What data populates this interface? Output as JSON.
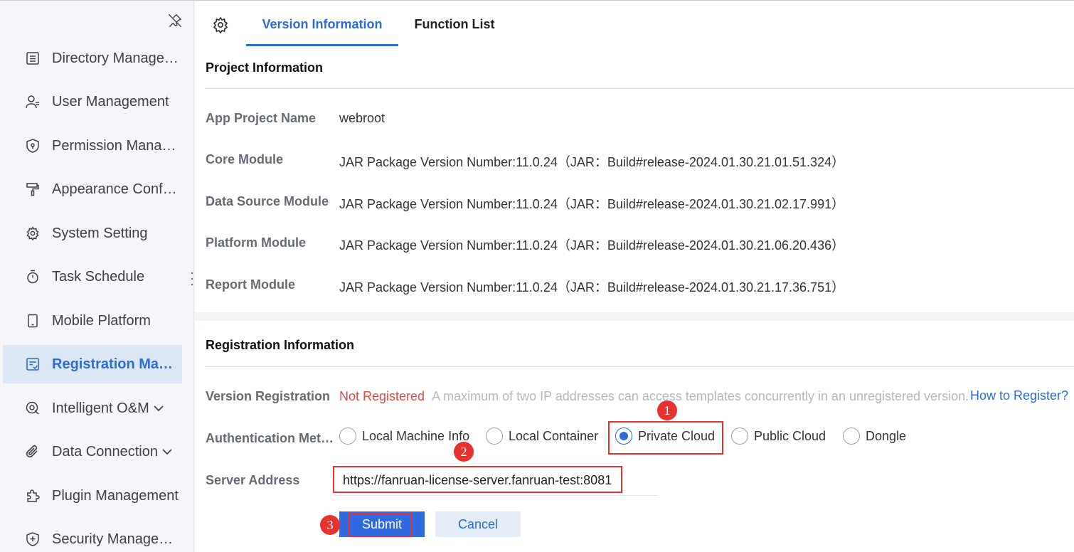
{
  "sidebar": {
    "pin_icon": "pin-off-icon",
    "items": [
      {
        "label": "Directory Management",
        "icon": "list-icon"
      },
      {
        "label": "User Management",
        "icon": "user-icon"
      },
      {
        "label": "Permission Management",
        "icon": "shield-icon"
      },
      {
        "label": "Appearance Configuration",
        "icon": "paint-roller-icon"
      },
      {
        "label": "System Setting",
        "icon": "gear-icon"
      },
      {
        "label": "Task Schedule",
        "icon": "stopwatch-icon"
      },
      {
        "label": "Mobile Platform",
        "icon": "mobile-icon"
      },
      {
        "label": "Registration Management",
        "icon": "registration-icon",
        "active": true
      },
      {
        "label": "Intelligent O&M",
        "icon": "ops-icon",
        "has_children": true
      },
      {
        "label": "Data Connection",
        "icon": "paperclip-icon",
        "has_children": true
      },
      {
        "label": "Plugin Management",
        "icon": "puzzle-icon"
      },
      {
        "label": "Security Management",
        "icon": "shield-plus-icon"
      }
    ]
  },
  "tabs": {
    "settings_icon": "gear-icon",
    "version": "Version Information",
    "function": "Function List",
    "active": "version"
  },
  "project": {
    "title": "Project Information",
    "rows": [
      {
        "label": "App Project Name",
        "value": "webroot"
      },
      {
        "label": "Core Module",
        "value": "JAR Package Version Number:11.0.24（JAR：Build#release-2024.01.30.21.01.51.324）"
      },
      {
        "label": "Data Source Module",
        "value": "JAR Package Version Number:11.0.24（JAR：Build#release-2024.01.30.21.02.17.991）"
      },
      {
        "label": "Platform Module",
        "value": "JAR Package Version Number:11.0.24（JAR：Build#release-2024.01.30.21.06.20.436）"
      },
      {
        "label": "Report Module",
        "value": "JAR Package Version Number:11.0.24（JAR：Build#release-2024.01.30.21.17.36.751）"
      }
    ]
  },
  "registration": {
    "title": "Registration Information",
    "version_label": "Version Registration",
    "status": "Not Registered",
    "hint": "A maximum of two IP addresses can access templates concurrently in an unregistered version.",
    "help_link": "How to Register?",
    "auth_label": "Authentication Method",
    "auth_options": [
      {
        "label": "Local Machine Info",
        "checked": false
      },
      {
        "label": "Local Container",
        "checked": false
      },
      {
        "label": "Private Cloud",
        "checked": true
      },
      {
        "label": "Public Cloud",
        "checked": false
      },
      {
        "label": "Dongle",
        "checked": false
      }
    ],
    "server_label": "Server Address",
    "server_value": "https://fanruan-license-server.fanruan-test:8081",
    "submit": "Submit",
    "cancel": "Cancel"
  },
  "annotations": [
    "1",
    "2",
    "3"
  ],
  "colors": {
    "accent": "#2c6bd8",
    "error": "#e04a44",
    "annotation": "#e8322f",
    "active_nav_bg": "#dde8f6"
  }
}
